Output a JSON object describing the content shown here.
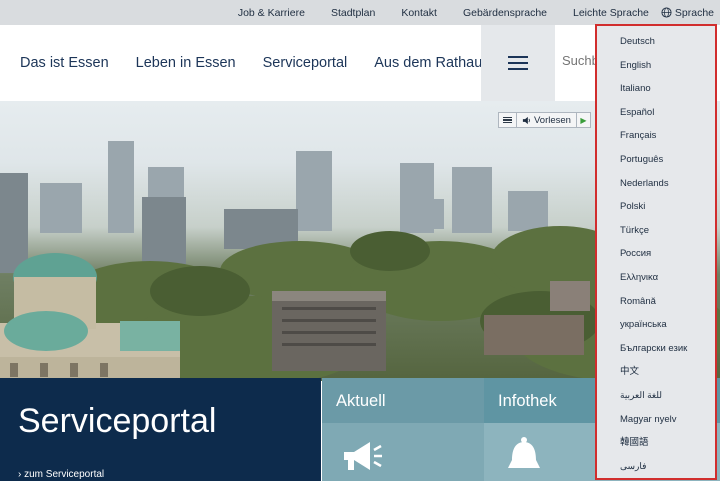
{
  "topbar": {
    "links": [
      "Job & Karriere",
      "Stadtplan",
      "Kontakt",
      "Gebärdensprache",
      "Leichte Sprache"
    ],
    "language_label": "Sprache"
  },
  "nav": {
    "items": [
      "Das ist Essen",
      "Leben in Essen",
      "Serviceportal",
      "Aus dem Rathaus"
    ]
  },
  "search": {
    "placeholder": "Suchb"
  },
  "reader": {
    "read_label": "Vorlesen"
  },
  "tiles": {
    "serviceportal": {
      "title": "Serviceportal",
      "link": "› zum Serviceportal"
    },
    "aktuell": {
      "title": "Aktuell"
    },
    "infothek": {
      "title": "Infothek"
    }
  },
  "language_menu": {
    "options": [
      "Deutsch",
      "English",
      "Italiano",
      "Español",
      "Français",
      "Português",
      "Nederlands",
      "Polski",
      "Türkçe",
      "Россия",
      "Ελληνικα",
      "Română",
      "українська",
      "Български език",
      "中文",
      "للغة العربية",
      "Magyar nyelv",
      "韓國語",
      "فارسی"
    ]
  },
  "colors": {
    "topbar_bg": "#d9dcdf",
    "primary_dark": "#0d2b4c",
    "tile_teal": "#6b9aa7",
    "dropdown_border": "#d12d2d"
  },
  "icons": {
    "language": "globe-icon",
    "menu": "hamburger-icon",
    "reader": "speaker-icon",
    "aktuell": "megaphone-icon",
    "infothek": "bell-icon"
  }
}
